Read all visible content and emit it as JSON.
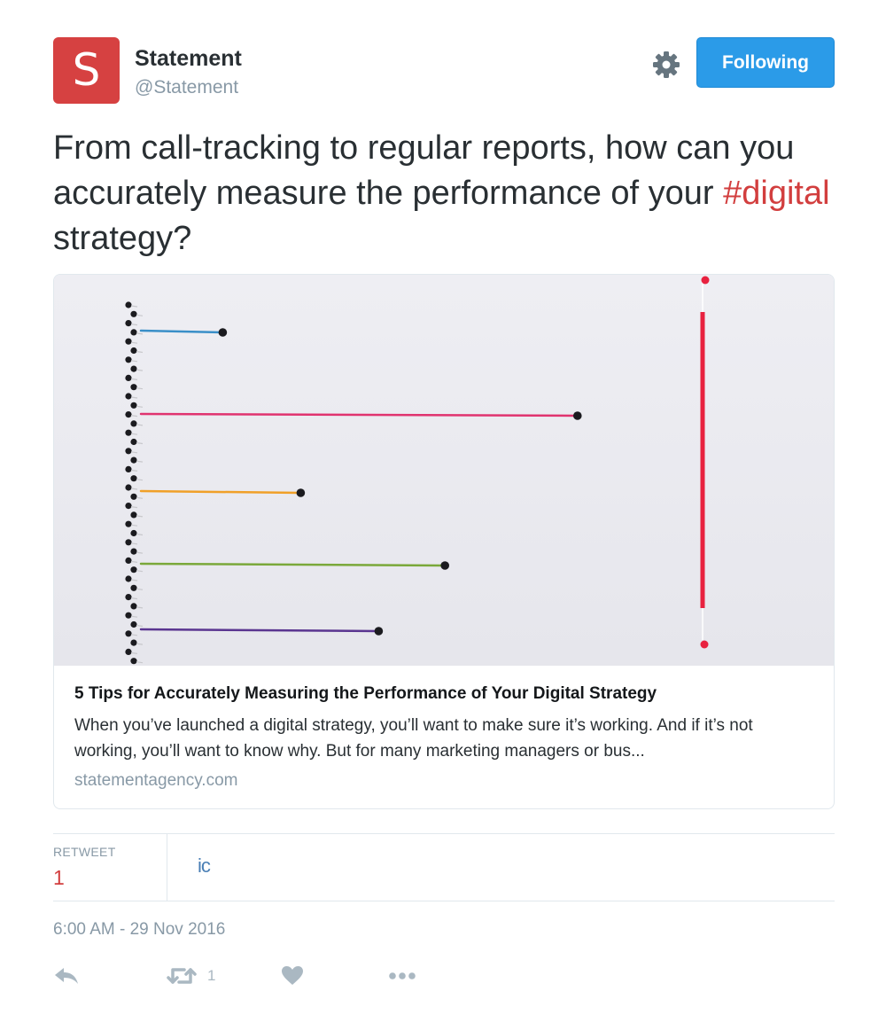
{
  "author": {
    "avatar_letter": "S",
    "avatar_color": "#d64141",
    "name": "Statement",
    "handle": "@Statement"
  },
  "header": {
    "settings_icon": "gear-icon",
    "follow_button_label": "Following",
    "follow_button_color": "#2b9be8"
  },
  "tweet": {
    "text_before": "From call-tracking to regular reports, how can you accurately measure the performance of your ",
    "hashtag": "#digital",
    "text_after": " strategy?",
    "hashtag_color": "#d23e3e"
  },
  "card": {
    "title": "5 Tips for Accurately Measuring the Performance of Your Digital Strategy",
    "description": "When you’ve launched a digital strategy, you’ll want to make sure it’s working. And if it’s not working, you’ll want to know why. But for many marketing managers or bus...",
    "domain": "statementagency.com",
    "image": {
      "thread_colors": [
        "#3a8fc8",
        "#e0336f",
        "#f0a028",
        "#7aa83a",
        "#5a3590"
      ],
      "thread_levels": [
        0.105,
        0.56,
        0.205,
        0.39,
        0.305
      ],
      "vertical_thread_color": "#e8213f"
    }
  },
  "stats": {
    "retweet_label": "RETWEET",
    "retweet_count": "1",
    "retweeter_avatar_text": "ic"
  },
  "timestamp": "6:00 AM - 29 Nov 2016",
  "actions": {
    "reply_icon": "reply-icon",
    "retweet_icon": "retweet-icon",
    "retweet_count": "1",
    "like_icon": "heart-icon",
    "more_icon": "more-icon"
  }
}
